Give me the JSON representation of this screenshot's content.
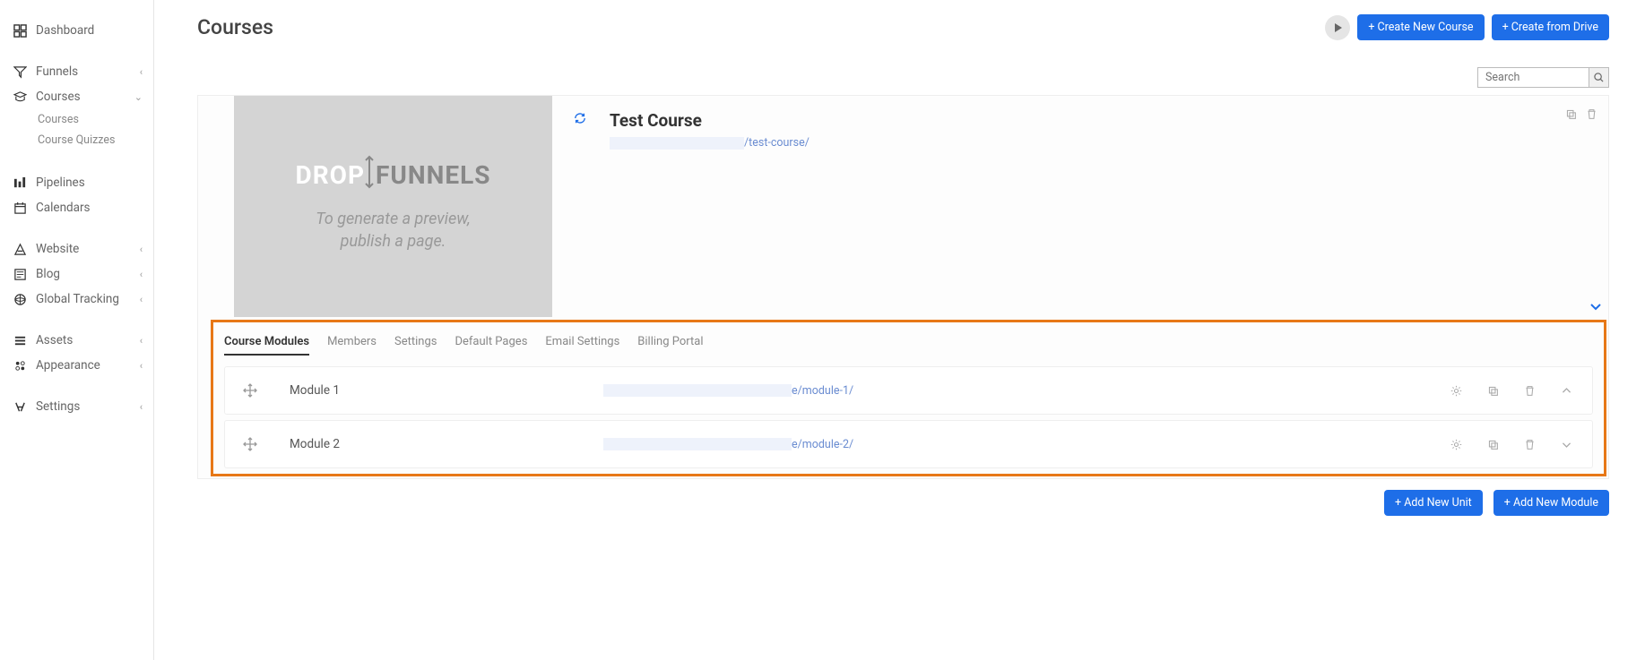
{
  "sidebar": {
    "dashboard": "Dashboard",
    "funnels": "Funnels",
    "courses": "Courses",
    "courses_sub": [
      "Courses",
      "Course Quizzes"
    ],
    "pipelines": "Pipelines",
    "calendars": "Calendars",
    "website": "Website",
    "blog": "Blog",
    "global_tracking": "Global Tracking",
    "assets": "Assets",
    "appearance": "Appearance",
    "settings": "Settings"
  },
  "page": {
    "title": "Courses",
    "create_course": "+ Create New Course",
    "create_drive": "+ Create from Drive",
    "search_placeholder": "Search"
  },
  "thumb": {
    "drop": "DROP",
    "funnels": "FUNNELS",
    "line1": "To generate a preview,",
    "line2": "publish a page."
  },
  "course": {
    "title": "Test Course",
    "url_suffix": "/test-course/"
  },
  "tabs": [
    "Course Modules",
    "Members",
    "Settings",
    "Default Pages",
    "Email Settings",
    "Billing Portal"
  ],
  "modules": [
    {
      "name": "Module 1",
      "url_suffix": "e/module-1/"
    },
    {
      "name": "Module 2",
      "url_suffix": "e/module-2/"
    }
  ],
  "buttons": {
    "add_unit": "+ Add New Unit",
    "add_module": "+ Add New Module"
  }
}
